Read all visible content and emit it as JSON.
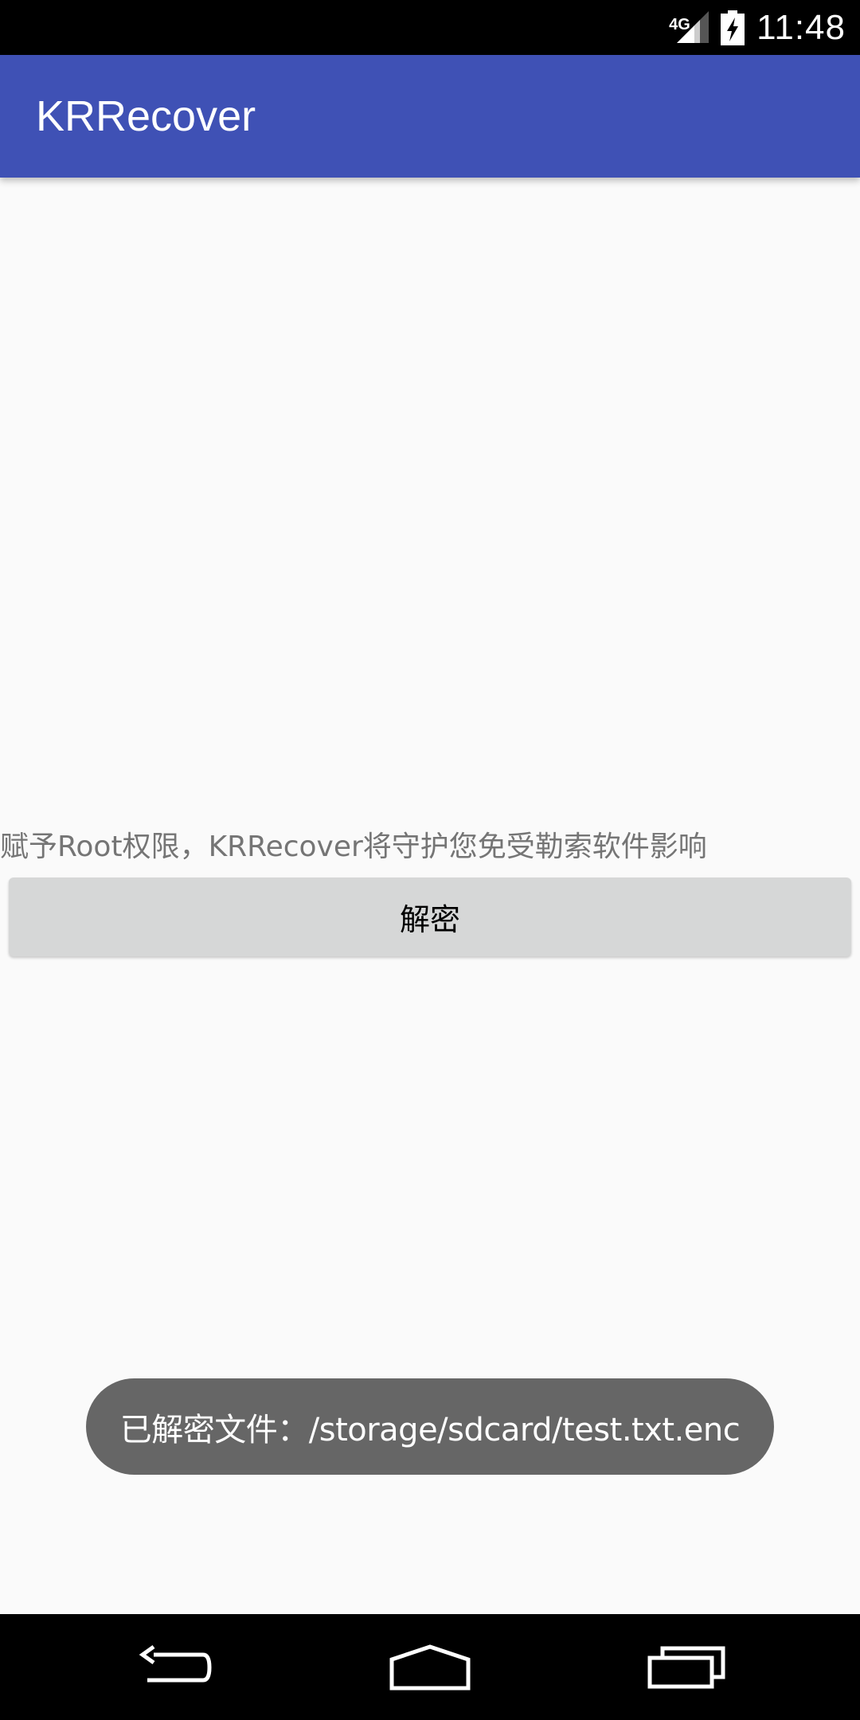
{
  "status_bar": {
    "network": "4G",
    "time": "11:48",
    "icons": [
      "signal-icon",
      "battery-charging-icon"
    ]
  },
  "app_bar": {
    "title": "KRRecover"
  },
  "main": {
    "info_text": "赋予Root权限，KRRecover将守护您免受勒索软件影响",
    "decrypt_button": "解密"
  },
  "toast": {
    "message": "已解密文件：/storage/sdcard/test.txt.enc"
  },
  "nav_bar": {
    "icons": [
      "back-icon",
      "home-icon",
      "recent-apps-icon"
    ]
  },
  "colors": {
    "primary": "#3f51b5",
    "background": "#fafafa",
    "button": "#d6d7d7",
    "toast": "#666666",
    "info_text": "#757575"
  }
}
